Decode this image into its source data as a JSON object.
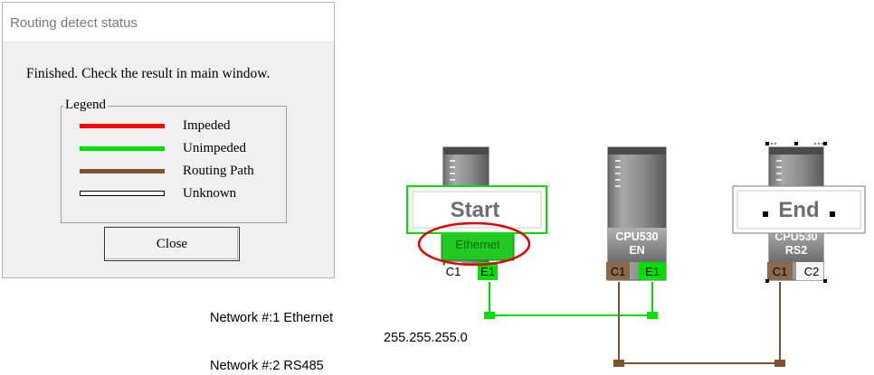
{
  "dialog": {
    "title": "Routing detect status",
    "message": "Finished. Check the result in main window.",
    "legend_title": "Legend",
    "legend": [
      {
        "label": "Impeded",
        "color": "#ff0000",
        "style": "solid"
      },
      {
        "label": "Unimpeded",
        "color": "#00e000",
        "style": "solid"
      },
      {
        "label": "Routing Path",
        "color": "#7a5532",
        "style": "solid"
      },
      {
        "label": "Unknown",
        "color": "#ffffff",
        "style": "outline"
      }
    ],
    "close_label": "Close"
  },
  "diagram": {
    "nodes": [
      {
        "id": "start-node",
        "tag": "Start",
        "module": "Ethernet",
        "ports": [
          "C1",
          "E1"
        ]
      },
      {
        "id": "middle-node",
        "module_line1": "CPU530",
        "module_line2": "EN",
        "ports": [
          "C1",
          "E1"
        ]
      },
      {
        "id": "end-node",
        "tag": "End",
        "module_line1": "CPU530",
        "module_line2": "RS2",
        "ports": [
          "C1",
          "C2"
        ]
      }
    ],
    "networks": [
      {
        "label": "Network #:1  Ethernet",
        "address": "255.255.255.0"
      },
      {
        "label": "Network #:2  RS485"
      }
    ]
  },
  "colors": {
    "unimpeded": "#00e000",
    "routing_path": "#7a5532",
    "highlight": "#e00000"
  }
}
